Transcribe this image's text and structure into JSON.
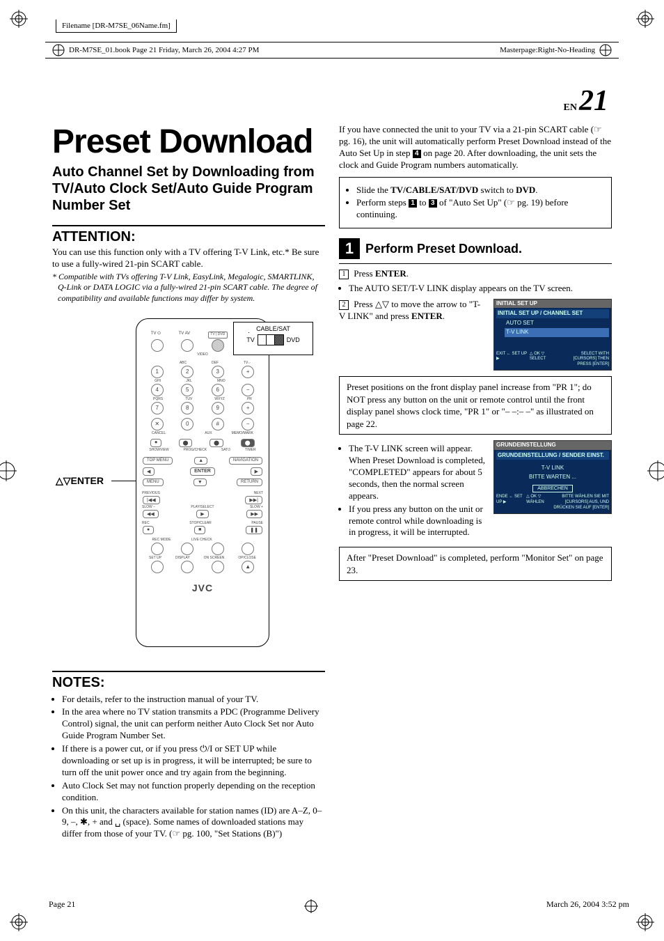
{
  "meta": {
    "filename_label": "Filename [DR-M7SE_06Name.fm]",
    "book_line": "DR-M7SE_01.book  Page 21  Friday, March 26, 2004  4:27 PM",
    "masterpage": "Masterpage:Right-No-Heading",
    "page_en": "EN",
    "page_num_big": "21",
    "footer_left": "Page 21",
    "footer_right": "March 26, 2004  3:52 pm"
  },
  "left": {
    "title": "Preset Download",
    "subtitle": "Auto Channel Set by Downloading from TV/Auto Clock Set/Auto Guide Program Number Set",
    "attention_head": "ATTENTION:",
    "attention_body": "You can use this function only with a TV offering T-V Link, etc.* Be sure to use a fully-wired 21-pin SCART cable.",
    "attention_note": "* Compatible with TVs offering T-V Link, EasyLink, Megalogic, SMARTLINK, Q-Link or DATA LOGIC via a fully-wired 21-pin SCART cable. The degree of compatibility and available functions may differ by system.",
    "enter_label": "△▽ENTER",
    "inset_top": "CABLE/SAT",
    "inset_tv": "TV",
    "inset_dvd": "DVD",
    "jvc": "JVC",
    "notes_head": "NOTES:",
    "notes": [
      "For details, refer to the instruction manual of your TV.",
      "In the area where no TV station transmits a PDC (Programme Delivery Control) signal, the unit can perform neither Auto Clock Set nor Auto Guide Program Number Set.",
      "If there is a power cut, or if you press ⏻/I or SET UP while downloading or set up is in progress, it will be interrupted; be sure to turn off the unit power once and try again from the beginning.",
      "Auto Clock Set may not function properly depending on the reception condition.",
      "On this unit, the characters available for station names (ID) are A–Z, 0–9, –, ✱, + and ␣ (space). Some names of downloaded stations may differ from those of your TV. (☞ pg. 100, \"Set Stations (B)\")"
    ]
  },
  "right": {
    "intro": "If you have connected the unit to your TV via a 21-pin SCART cable (☞ pg. 16), the unit will automatically perform Preset Download instead of the Auto Set Up in step 4 on page 20. After downloading, the unit sets the clock and Guide Program numbers automatically.",
    "box1_items": [
      "Slide the TV/CABLE/SAT/DVD switch to DVD.",
      "Perform steps 1 to 3 of \"Auto Set Up\" (☞ pg. 19) before continuing."
    ],
    "step_num": "1",
    "step_title": "Perform Preset Download.",
    "sub1_num": "1",
    "sub1_text": "Press ENTER.",
    "sub1_bullet": "The AUTO SET/T-V LINK display appears on the TV screen.",
    "sub2_num": "2",
    "sub2_text": "Press △▽ to move the arrow to \"T-V LINK\" and press ENTER.",
    "screen1": {
      "top": "INITIAL SET UP",
      "hdr": "INITIAL SET UP / CHANNEL SET",
      "rows": [
        "AUTO SET",
        "T-V LINK"
      ],
      "foot_left": "EXIT ←  SET UP ▶",
      "foot_mid": "△ OK ▽ SELECT",
      "foot_right": "SELECT WITH [CURSORS] THEN PRESS [ENTER]"
    },
    "box2": "Preset positions on the front display panel increase from \"PR 1\"; do NOT press any button on the unit or remote control until the front display panel shows clock time, \"PR 1\" or \"– –:– –\" as illustrated on page 22.",
    "post_bullets": [
      "The T-V LINK screen will appear. When Preset Download is completed, \"COMPLETED\" appears for about 5 seconds, then the normal screen appears.",
      "If you press any button on the unit or remote control while downloading is in progress, it will be interrupted."
    ],
    "screen2": {
      "top": "GRUNDEINSTELLUNG",
      "hdr": "GRUNDEINSTELLUNG / SENDER EINST.",
      "rows": [
        "T-V LINK",
        "BITTE WARTEN ..."
      ],
      "btn": "ABBRECHEN",
      "foot_left": "ENDE ←  SET UP ▶",
      "foot_mid": "△ OK ▽ WÄHLEN",
      "foot_right": "BITTE WÄHLEN SIE MIT [CURSORS] AUS, UND DRÜCKEN SIE AUF [ENTER]"
    },
    "box3": "After \"Preset Download\" is completed, perform \"Monitor Set\" on page 23."
  }
}
